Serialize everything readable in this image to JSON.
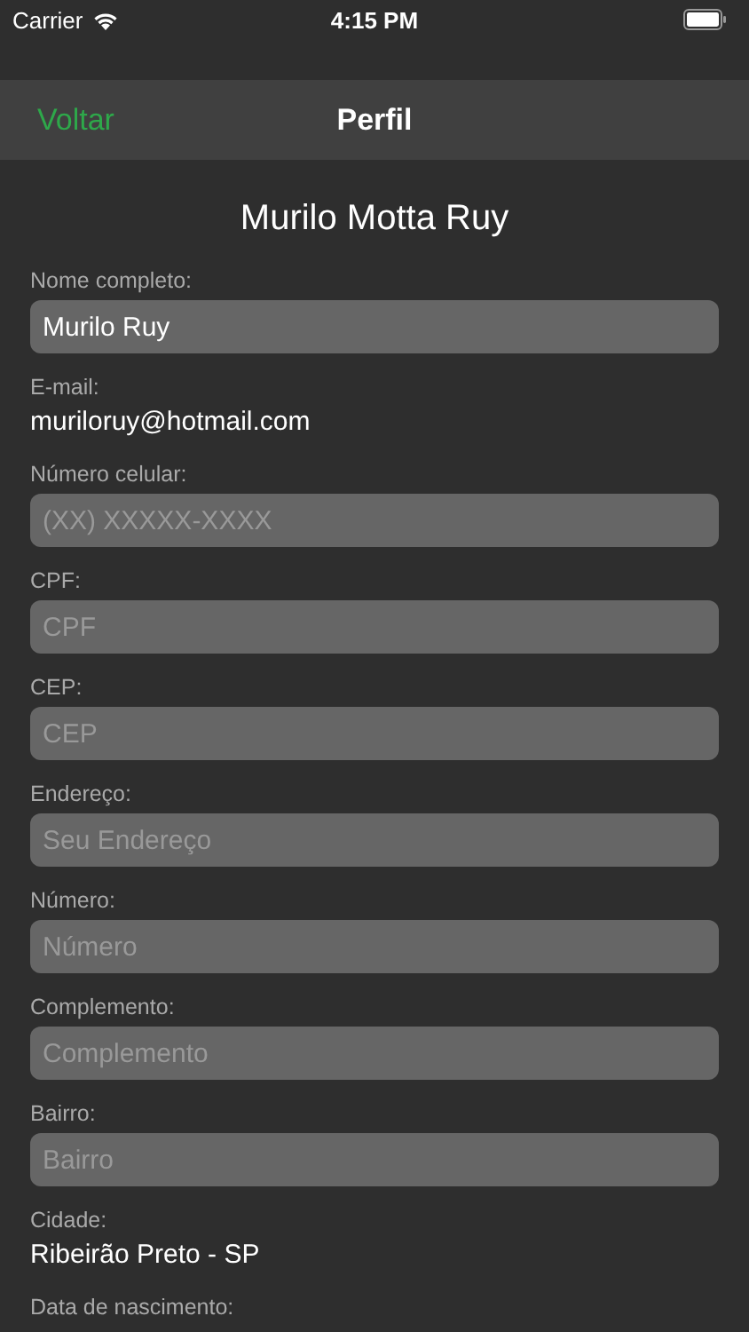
{
  "status_bar": {
    "carrier": "Carrier",
    "time": "4:15 PM"
  },
  "nav_bar": {
    "back": "Voltar",
    "title": "Perfil"
  },
  "profile_name": "Murilo Motta Ruy",
  "fields": [
    {
      "kind": "input",
      "label": "Nome completo:",
      "value": "Murilo Ruy"
    },
    {
      "kind": "text",
      "label": "E-mail:",
      "value": "muriloruy@hotmail.com"
    },
    {
      "kind": "input",
      "label": "Número celular:",
      "placeholder": "(XX) XXXXX-XXXX"
    },
    {
      "kind": "input",
      "label": "CPF:",
      "placeholder": "CPF"
    },
    {
      "kind": "input",
      "label": "CEP:",
      "placeholder": "CEP"
    },
    {
      "kind": "input",
      "label": "Endereço:",
      "placeholder": "Seu Endereço"
    },
    {
      "kind": "input",
      "label": "Número:",
      "placeholder": "Número"
    },
    {
      "kind": "input",
      "label": "Complemento:",
      "placeholder": "Complemento"
    },
    {
      "kind": "input",
      "label": "Bairro:",
      "placeholder": "Bairro"
    },
    {
      "kind": "text",
      "label": "Cidade:",
      "value": "Ribeirão Preto - SP"
    },
    {
      "kind": "label",
      "label": "Data de nascimento:"
    }
  ]
}
